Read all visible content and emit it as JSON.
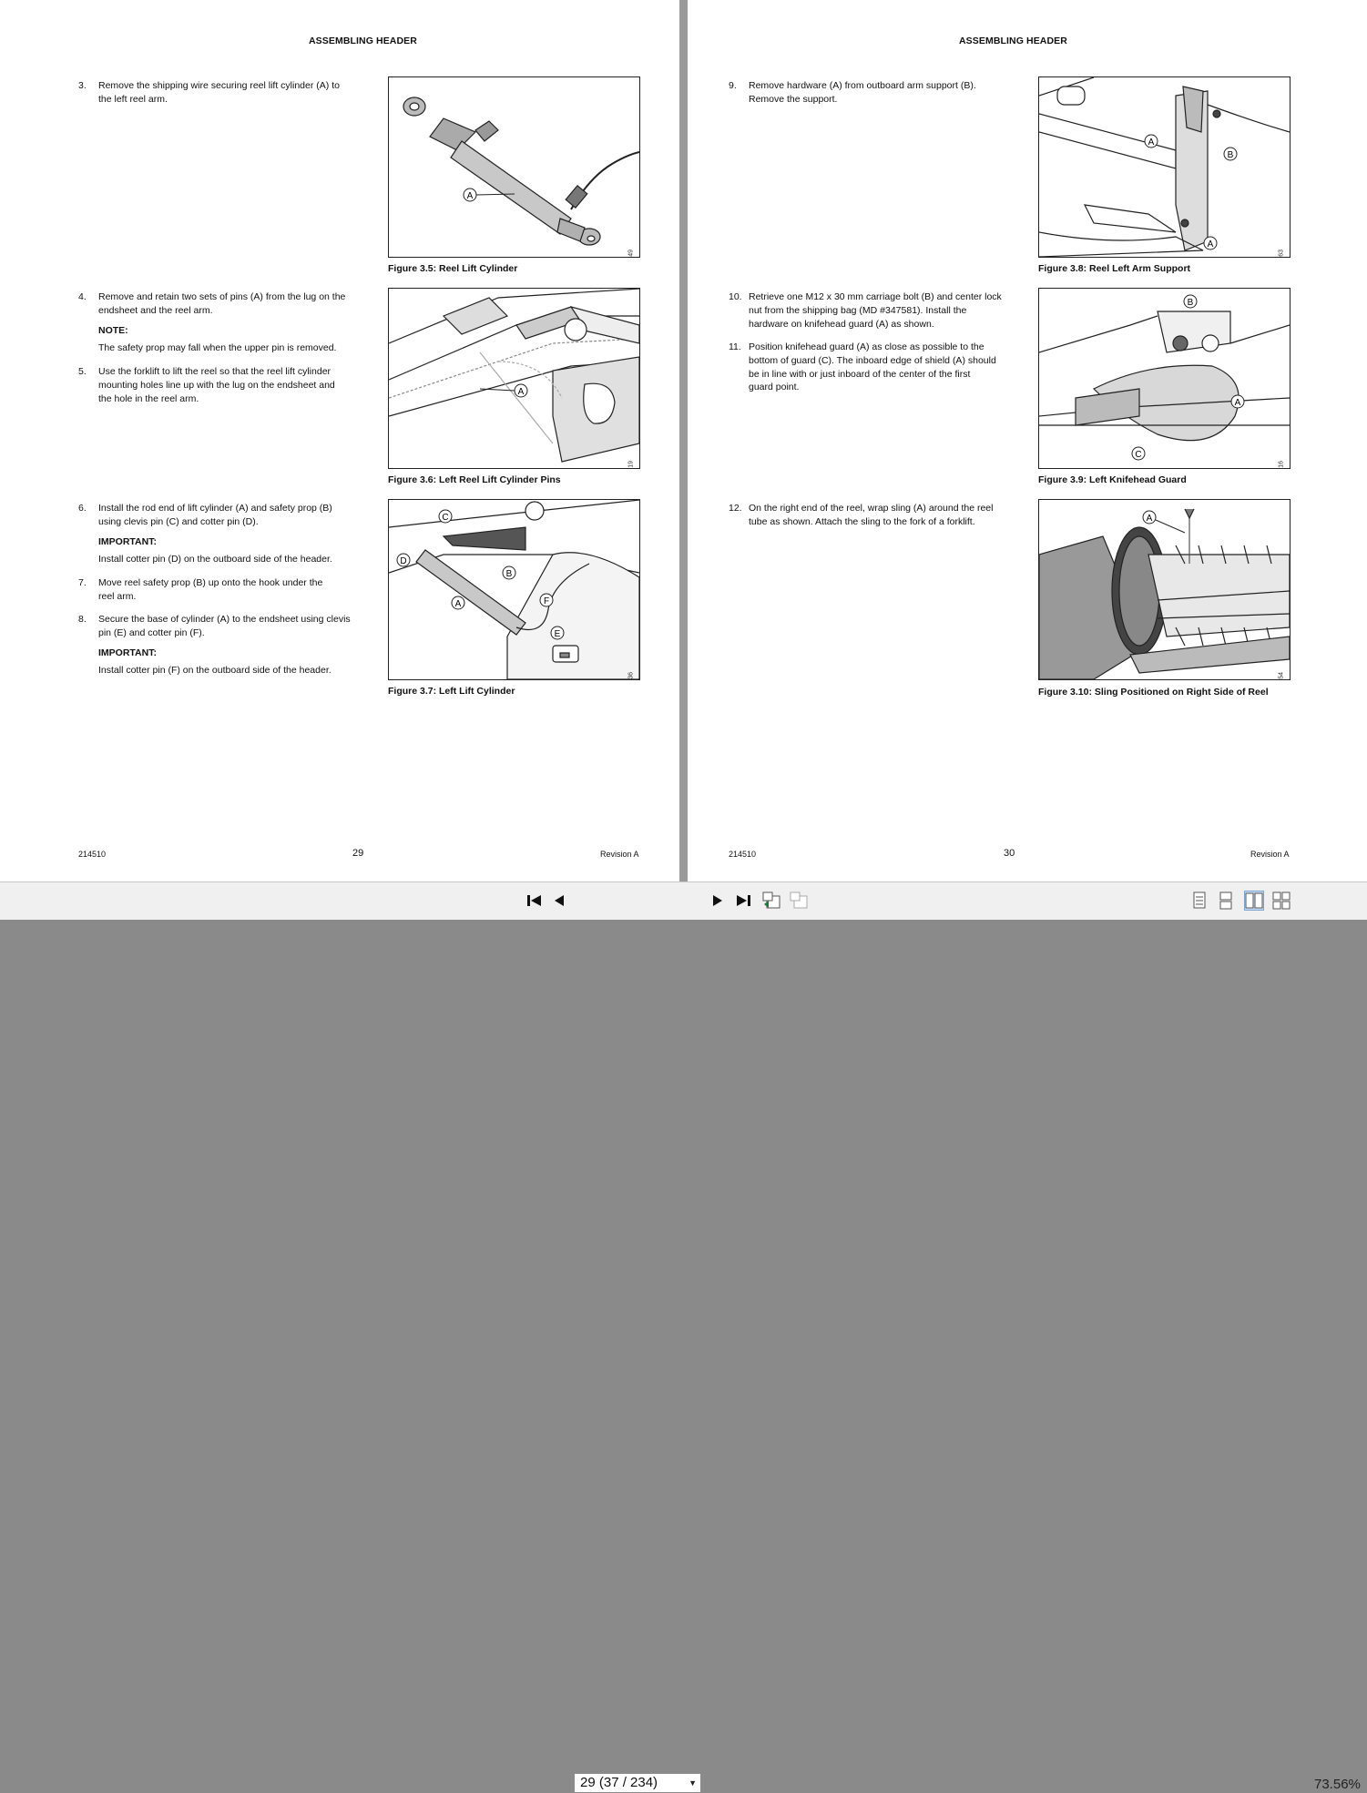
{
  "left_page": {
    "header": "ASSEMBLING HEADER",
    "steps": [
      {
        "num": "3.",
        "lines": [
          "Remove the shipping wire securing reel lift cylinder (A) to",
          "the left reel arm."
        ]
      },
      {
        "num": "4.",
        "lines": [
          "Remove and retain two sets of pins (A) from the lug on the",
          "endsheet and the reel arm."
        ]
      },
      {
        "num": "5.",
        "lines": [
          "Use the forklift to lift the reel so that the reel lift cylinder",
          "mounting holes line up with the lug on the endsheet and",
          "the hole in the reel arm."
        ]
      },
      {
        "num": "6.",
        "lines": [
          "Install the rod end of lift cylinder (A) and safety prop (B)",
          "using clevis pin (C) and cotter pin (D)."
        ]
      },
      {
        "num": "7.",
        "lines": [
          "Move reel safety prop (B) up onto the hook under the",
          "reel arm."
        ]
      },
      {
        "num": "8.",
        "lines": [
          "Secure the base of cylinder (A) to the endsheet using clevis",
          "pin (E) and cotter pin (F)."
        ]
      }
    ],
    "note_label": "NOTE:",
    "note_text": "The safety prop may fall when the upper pin is removed.",
    "important1_label": "IMPORTANT:",
    "important1_text": "Install cotter pin (D) on the outboard side of the header.",
    "important2_label": "IMPORTANT:",
    "important2_text": "Install cotter pin (F) on the outboard side of the header.",
    "figures": [
      {
        "caption": "Figure 3.5: Reel Lift Cylinder",
        "code": "1035949"
      },
      {
        "caption": "Figure 3.6: Left Reel Lift Cylinder Pins",
        "code": "1032519"
      },
      {
        "caption": "Figure 3.7: Left Lift Cylinder",
        "code": "1037036"
      }
    ],
    "footer_doc": "214510",
    "footer_page": "29",
    "footer_rev": "Revision A"
  },
  "right_page": {
    "header": "ASSEMBLING HEADER",
    "steps": [
      {
        "num": "9.",
        "lines": [
          "Remove hardware (A) from outboard arm support (B).",
          "Remove the support."
        ]
      },
      {
        "num": "10.",
        "lines": [
          "Retrieve one M12 x 30 mm carriage bolt (B) and center lock",
          "nut from the shipping bag (MD #347581). Install the",
          "hardware on knifehead guard (A) as shown."
        ]
      },
      {
        "num": "11.",
        "lines": [
          "Position knifehead guard (A) as close as possible to the",
          "bottom of guard (C). The inboard edge of shield (A) should",
          "be in line with or just inboard of the center of the first",
          "guard point."
        ]
      },
      {
        "num": "12.",
        "lines": [
          "On the right end of the reel, wrap sling (A) around the reel",
          "tube as shown. Attach the sling to the fork of a forklift."
        ]
      }
    ],
    "figures": [
      {
        "caption": "Figure 3.8: Reel Left Arm Support",
        "code": "1036563"
      },
      {
        "caption": "Figure 3.9: Left Knifehead Guard",
        "code": "1040716"
      },
      {
        "caption": "Figure 3.10: Sling Positioned on Right Side of Reel",
        "code": "1037054"
      }
    ],
    "footer_doc": "214510",
    "footer_page": "30",
    "footer_rev": "Revision A"
  },
  "toolbar": {
    "page_display": "29 (37 / 234)",
    "zoom": "73.56%"
  }
}
